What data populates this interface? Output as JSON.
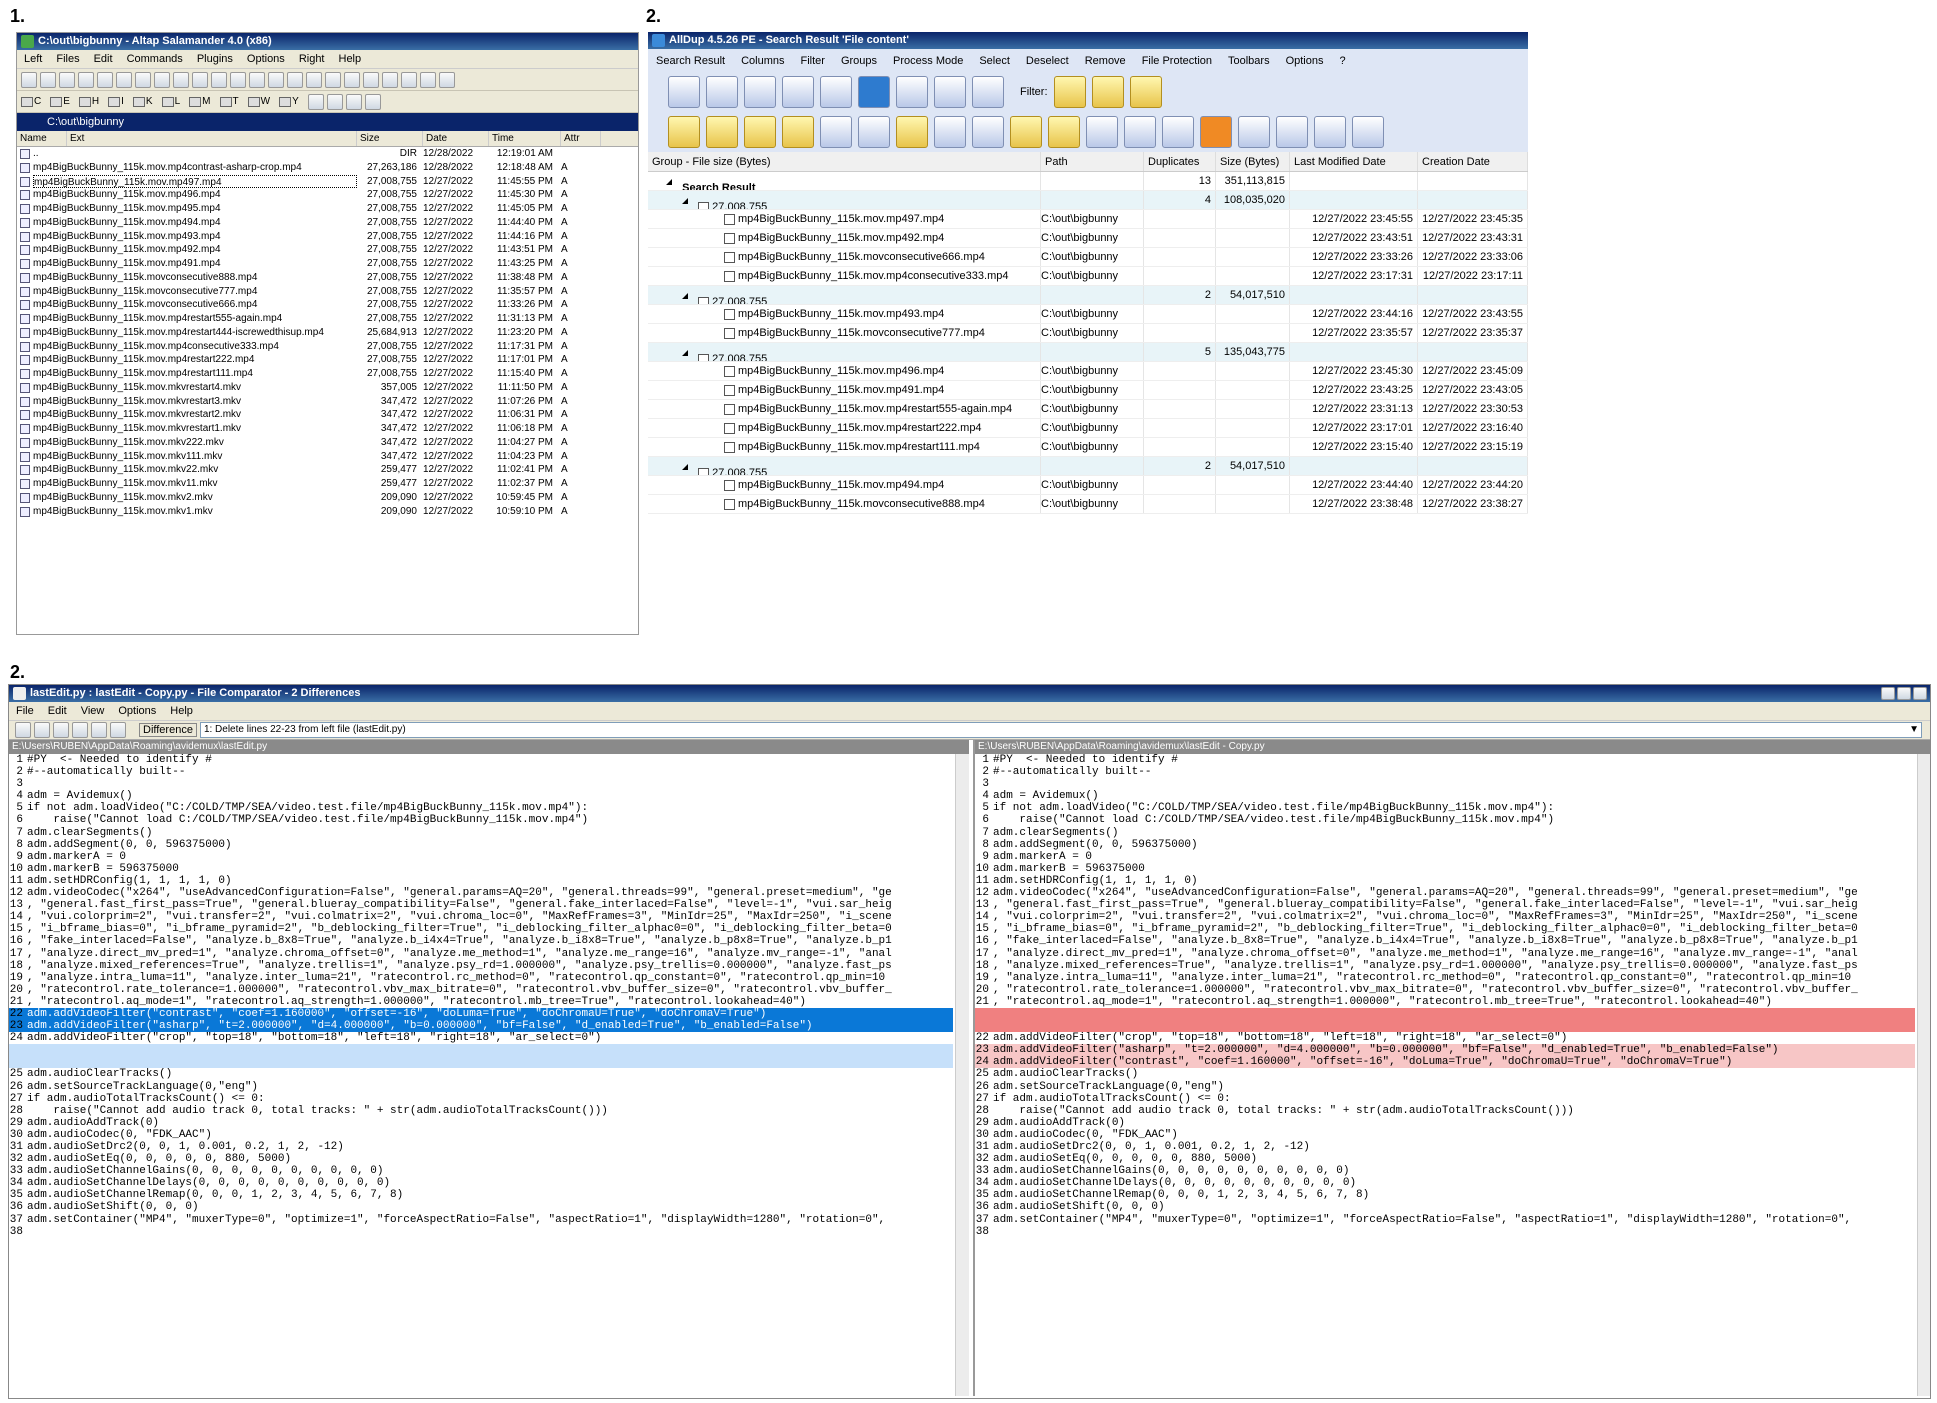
{
  "labels": {
    "one": "1.",
    "two_top": "2.",
    "two_bottom": "2."
  },
  "salamander": {
    "title": "C:\\out\\bigbunny - Altap Salamander 4.0 (x86)",
    "menu": [
      "Left",
      "Files",
      "Edit",
      "Commands",
      "Plugins",
      "Options",
      "Right",
      "Help"
    ],
    "drives": [
      "C",
      "E",
      "H",
      "I",
      "K",
      "L",
      "M",
      "T",
      "W",
      "Y"
    ],
    "path": "C:\\out\\bigbunny",
    "columns": [
      "Name",
      "Ext",
      "Size",
      "Date",
      "Time",
      "Attr"
    ],
    "files": [
      {
        "name": "..",
        "size": "DIR",
        "date": "12/28/2022",
        "time": "12:19:01 AM",
        "attr": ""
      },
      {
        "name": "mp4BigBuckBunny_115k.mov.mp4contrast-asharp-crop.mp4",
        "size": "27,263,186",
        "date": "12/28/2022",
        "time": "12:18:48 AM",
        "attr": "A"
      },
      {
        "name": "mp4BigBuckBunny_115k.mov.mp497.mp4",
        "size": "27,008,755",
        "date": "12/27/2022",
        "time": "11:45:55 PM",
        "attr": "A"
      },
      {
        "name": "mp4BigBuckBunny_115k.mov.mp496.mp4",
        "size": "27,008,755",
        "date": "12/27/2022",
        "time": "11:45:30 PM",
        "attr": "A"
      },
      {
        "name": "mp4BigBuckBunny_115k.mov.mp495.mp4",
        "size": "27,008,755",
        "date": "12/27/2022",
        "time": "11:45:05 PM",
        "attr": "A"
      },
      {
        "name": "mp4BigBuckBunny_115k.mov.mp494.mp4",
        "size": "27,008,755",
        "date": "12/27/2022",
        "time": "11:44:40 PM",
        "attr": "A"
      },
      {
        "name": "mp4BigBuckBunny_115k.mov.mp493.mp4",
        "size": "27,008,755",
        "date": "12/27/2022",
        "time": "11:44:16 PM",
        "attr": "A"
      },
      {
        "name": "mp4BigBuckBunny_115k.mov.mp492.mp4",
        "size": "27,008,755",
        "date": "12/27/2022",
        "time": "11:43:51 PM",
        "attr": "A"
      },
      {
        "name": "mp4BigBuckBunny_115k.mov.mp491.mp4",
        "size": "27,008,755",
        "date": "12/27/2022",
        "time": "11:43:25 PM",
        "attr": "A"
      },
      {
        "name": "mp4BigBuckBunny_115k.movconsecutive888.mp4",
        "size": "27,008,755",
        "date": "12/27/2022",
        "time": "11:38:48 PM",
        "attr": "A"
      },
      {
        "name": "mp4BigBuckBunny_115k.movconsecutive777.mp4",
        "size": "27,008,755",
        "date": "12/27/2022",
        "time": "11:35:57 PM",
        "attr": "A"
      },
      {
        "name": "mp4BigBuckBunny_115k.movconsecutive666.mp4",
        "size": "27,008,755",
        "date": "12/27/2022",
        "time": "11:33:26 PM",
        "attr": "A"
      },
      {
        "name": "mp4BigBuckBunny_115k.mov.mp4restart555-again.mp4",
        "size": "27,008,755",
        "date": "12/27/2022",
        "time": "11:31:13 PM",
        "attr": "A"
      },
      {
        "name": "mp4BigBuckBunny_115k.mov.mp4restart444-iscrewedthisup.mp4",
        "size": "25,684,913",
        "date": "12/27/2022",
        "time": "11:23:20 PM",
        "attr": "A"
      },
      {
        "name": "mp4BigBuckBunny_115k.mov.mp4consecutive333.mp4",
        "size": "27,008,755",
        "date": "12/27/2022",
        "time": "11:17:31 PM",
        "attr": "A"
      },
      {
        "name": "mp4BigBuckBunny_115k.mov.mp4restart222.mp4",
        "size": "27,008,755",
        "date": "12/27/2022",
        "time": "11:17:01 PM",
        "attr": "A"
      },
      {
        "name": "mp4BigBuckBunny_115k.mov.mp4restart111.mp4",
        "size": "27,008,755",
        "date": "12/27/2022",
        "time": "11:15:40 PM",
        "attr": "A"
      },
      {
        "name": "mp4BigBuckBunny_115k.mov.mkvrestart4.mkv",
        "size": "357,005",
        "date": "12/27/2022",
        "time": "11:11:50 PM",
        "attr": "A"
      },
      {
        "name": "mp4BigBuckBunny_115k.mov.mkvrestart3.mkv",
        "size": "347,472",
        "date": "12/27/2022",
        "time": "11:07:26 PM",
        "attr": "A"
      },
      {
        "name": "mp4BigBuckBunny_115k.mov.mkvrestart2.mkv",
        "size": "347,472",
        "date": "12/27/2022",
        "time": "11:06:31 PM",
        "attr": "A"
      },
      {
        "name": "mp4BigBuckBunny_115k.mov.mkvrestart1.mkv",
        "size": "347,472",
        "date": "12/27/2022",
        "time": "11:06:18 PM",
        "attr": "A"
      },
      {
        "name": "mp4BigBuckBunny_115k.mov.mkv222.mkv",
        "size": "347,472",
        "date": "12/27/2022",
        "time": "11:04:27 PM",
        "attr": "A"
      },
      {
        "name": "mp4BigBuckBunny_115k.mov.mkv111.mkv",
        "size": "347,472",
        "date": "12/27/2022",
        "time": "11:04:23 PM",
        "attr": "A"
      },
      {
        "name": "mp4BigBuckBunny_115k.mov.mkv22.mkv",
        "size": "259,477",
        "date": "12/27/2022",
        "time": "11:02:41 PM",
        "attr": "A"
      },
      {
        "name": "mp4BigBuckBunny_115k.mov.mkv11.mkv",
        "size": "259,477",
        "date": "12/27/2022",
        "time": "11:02:37 PM",
        "attr": "A"
      },
      {
        "name": "mp4BigBuckBunny_115k.mov.mkv2.mkv",
        "size": "209,090",
        "date": "12/27/2022",
        "time": "10:59:45 PM",
        "attr": "A"
      },
      {
        "name": "mp4BigBuckBunny_115k.mov.mkv1.mkv",
        "size": "209,090",
        "date": "12/27/2022",
        "time": "10:59:10 PM",
        "attr": "A"
      }
    ]
  },
  "alldup": {
    "title": "AllDup 4.5.26 PE - Search Result 'File content'",
    "menu": [
      "Search Result",
      "Columns",
      "Filter",
      "Groups",
      "Process Mode",
      "Select",
      "Deselect",
      "Remove",
      "File Protection",
      "Toolbars",
      "Options",
      "?"
    ],
    "filter_label": "Filter:",
    "columns": [
      "Group - File size (Bytes)",
      "Path",
      "Duplicates",
      "Size (Bytes)",
      "Last Modified Date",
      "Creation Date"
    ],
    "root": {
      "label": "Search Result",
      "dups": "13",
      "size": "351,113,815"
    },
    "groups": [
      {
        "label": "27,008,755",
        "dups": "4",
        "size": "108,035,020",
        "files": [
          {
            "name": "mp4BigBuckBunny_115k.mov.mp497.mp4",
            "path": "C:\\out\\bigbunny",
            "mod": "12/27/2022 23:45:55",
            "cre": "12/27/2022 23:45:35"
          },
          {
            "name": "mp4BigBuckBunny_115k.mov.mp492.mp4",
            "path": "C:\\out\\bigbunny",
            "mod": "12/27/2022 23:43:51",
            "cre": "12/27/2022 23:43:31"
          },
          {
            "name": "mp4BigBuckBunny_115k.movconsecutive666.mp4",
            "path": "C:\\out\\bigbunny",
            "mod": "12/27/2022 23:33:26",
            "cre": "12/27/2022 23:33:06"
          },
          {
            "name": "mp4BigBuckBunny_115k.mov.mp4consecutive333.mp4",
            "path": "C:\\out\\bigbunny",
            "mod": "12/27/2022 23:17:31",
            "cre": "12/27/2022 23:17:11"
          }
        ]
      },
      {
        "label": "27,008,755",
        "dups": "2",
        "size": "54,017,510",
        "files": [
          {
            "name": "mp4BigBuckBunny_115k.mov.mp493.mp4",
            "path": "C:\\out\\bigbunny",
            "mod": "12/27/2022 23:44:16",
            "cre": "12/27/2022 23:43:55"
          },
          {
            "name": "mp4BigBuckBunny_115k.movconsecutive777.mp4",
            "path": "C:\\out\\bigbunny",
            "mod": "12/27/2022 23:35:57",
            "cre": "12/27/2022 23:35:37"
          }
        ]
      },
      {
        "label": "27,008,755",
        "dups": "5",
        "size": "135,043,775",
        "files": [
          {
            "name": "mp4BigBuckBunny_115k.mov.mp496.mp4",
            "path": "C:\\out\\bigbunny",
            "mod": "12/27/2022 23:45:30",
            "cre": "12/27/2022 23:45:09"
          },
          {
            "name": "mp4BigBuckBunny_115k.mov.mp491.mp4",
            "path": "C:\\out\\bigbunny",
            "mod": "12/27/2022 23:43:25",
            "cre": "12/27/2022 23:43:05"
          },
          {
            "name": "mp4BigBuckBunny_115k.mov.mp4restart555-again.mp4",
            "path": "C:\\out\\bigbunny",
            "mod": "12/27/2022 23:31:13",
            "cre": "12/27/2022 23:30:53"
          },
          {
            "name": "mp4BigBuckBunny_115k.mov.mp4restart222.mp4",
            "path": "C:\\out\\bigbunny",
            "mod": "12/27/2022 23:17:01",
            "cre": "12/27/2022 23:16:40"
          },
          {
            "name": "mp4BigBuckBunny_115k.mov.mp4restart111.mp4",
            "path": "C:\\out\\bigbunny",
            "mod": "12/27/2022 23:15:40",
            "cre": "12/27/2022 23:15:19"
          }
        ]
      },
      {
        "label": "27,008,755",
        "dups": "2",
        "size": "54,017,510",
        "files": [
          {
            "name": "mp4BigBuckBunny_115k.mov.mp494.mp4",
            "path": "C:\\out\\bigbunny",
            "mod": "12/27/2022 23:44:40",
            "cre": "12/27/2022 23:44:20"
          },
          {
            "name": "mp4BigBuckBunny_115k.movconsecutive888.mp4",
            "path": "C:\\out\\bigbunny",
            "mod": "12/27/2022 23:38:48",
            "cre": "12/27/2022 23:38:27"
          }
        ]
      }
    ]
  },
  "comparator": {
    "title": "lastEdit.py : lastEdit - Copy.py - File Comparator - 2 Differences",
    "menu": [
      "File",
      "Edit",
      "View",
      "Options",
      "Help"
    ],
    "difference_label": "Difference",
    "difference_value": "1: Delete lines 22-23 from left file (lastEdit.py)",
    "left_path": "E:\\Users\\RUBEN\\AppData\\Roaming\\avidemux\\lastEdit.py",
    "right_path": "E:\\Users\\RUBEN\\AppData\\Roaming\\avidemux\\lastEdit - Copy.py",
    "left": [
      {
        "n": "1",
        "t": "#PY  <- Needed to identify #"
      },
      {
        "n": "2",
        "t": "#--automatically built--"
      },
      {
        "n": "3",
        "t": ""
      },
      {
        "n": "4",
        "t": "adm = Avidemux()"
      },
      {
        "n": "5",
        "t": "if not adm.loadVideo(\"C:/COLD/TMP/SEA/video.test.file/mp4BigBuckBunny_115k.mov.mp4\"):"
      },
      {
        "n": "6",
        "t": "    raise(\"Cannot load C:/COLD/TMP/SEA/video.test.file/mp4BigBuckBunny_115k.mov.mp4\")"
      },
      {
        "n": "7",
        "t": "adm.clearSegments()"
      },
      {
        "n": "8",
        "t": "adm.addSegment(0, 0, 596375000)"
      },
      {
        "n": "9",
        "t": "adm.markerA = 0"
      },
      {
        "n": "10",
        "t": "adm.markerB = 596375000"
      },
      {
        "n": "11",
        "t": "adm.setHDRConfig(1, 1, 1, 1, 0)"
      },
      {
        "n": "12",
        "t": "adm.videoCodec(\"x264\", \"useAdvancedConfiguration=False\", \"general.params=AQ=20\", \"general.threads=99\", \"general.preset=medium\", \"ge"
      },
      {
        "n": "13",
        "t": ", \"general.fast_first_pass=True\", \"general.blueray_compatibility=False\", \"general.fake_interlaced=False\", \"level=-1\", \"vui.sar_heig"
      },
      {
        "n": "14",
        "t": ", \"vui.colorprim=2\", \"vui.transfer=2\", \"vui.colmatrix=2\", \"vui.chroma_loc=0\", \"MaxRefFrames=3\", \"MinIdr=25\", \"MaxIdr=250\", \"i_scene"
      },
      {
        "n": "15",
        "t": ", \"i_bframe_bias=0\", \"i_bframe_pyramid=2\", \"b_deblocking_filter=True\", \"i_deblocking_filter_alphac0=0\", \"i_deblocking_filter_beta=0"
      },
      {
        "n": "16",
        "t": ", \"fake_interlaced=False\", \"analyze.b_8x8=True\", \"analyze.b_i4x4=True\", \"analyze.b_i8x8=True\", \"analyze.b_p8x8=True\", \"analyze.b_p1"
      },
      {
        "n": "17",
        "t": ", \"analyze.direct_mv_pred=1\", \"analyze.chroma_offset=0\", \"analyze.me_method=1\", \"analyze.me_range=16\", \"analyze.mv_range=-1\", \"anal"
      },
      {
        "n": "18",
        "t": ", \"analyze.mixed_references=True\", \"analyze.trellis=1\", \"analyze.psy_rd=1.000000\", \"analyze.psy_trellis=0.000000\", \"analyze.fast_ps"
      },
      {
        "n": "19",
        "t": ", \"analyze.intra_luma=11\", \"analyze.inter_luma=21\", \"ratecontrol.rc_method=0\", \"ratecontrol.qp_constant=0\", \"ratecontrol.qp_min=10"
      },
      {
        "n": "20",
        "t": ", \"ratecontrol.rate_tolerance=1.000000\", \"ratecontrol.vbv_max_bitrate=0\", \"ratecontrol.vbv_buffer_size=0\", \"ratecontrol.vbv_buffer_"
      },
      {
        "n": "21",
        "t": ", \"ratecontrol.aq_mode=1\", \"ratecontrol.aq_strength=1.000000\", \"ratecontrol.mb_tree=True\", \"ratecontrol.lookahead=40\")"
      },
      {
        "n": "22",
        "t": "adm.addVideoFilter(\"contrast\", \"coef=1.160000\", \"offset=-16\", \"doLuma=True\", \"doChromaU=True\", \"doChromaV=True\")",
        "c": "dl"
      },
      {
        "n": "23",
        "t": "adm.addVideoFilter(\"asharp\", \"t=2.000000\", \"d=4.000000\", \"b=0.000000\", \"bf=False\", \"d_enabled=True\", \"b_enabled=False\")",
        "c": "dl"
      },
      {
        "n": "24",
        "t": "adm.addVideoFilter(\"crop\", \"top=18\", \"bottom=18\", \"left=18\", \"right=18\", \"ar_select=0\")"
      },
      {
        "n": "",
        "t": "",
        "c": "dlp"
      },
      {
        "n": "",
        "t": "",
        "c": "dlp"
      },
      {
        "n": "25",
        "t": "adm.audioClearTracks()"
      },
      {
        "n": "26",
        "t": "adm.setSourceTrackLanguage(0,\"eng\")"
      },
      {
        "n": "27",
        "t": "if adm.audioTotalTracksCount() <= 0:"
      },
      {
        "n": "28",
        "t": "    raise(\"Cannot add audio track 0, total tracks: \" + str(adm.audioTotalTracksCount()))"
      },
      {
        "n": "29",
        "t": "adm.audioAddTrack(0)"
      },
      {
        "n": "30",
        "t": "adm.audioCodec(0, \"FDK_AAC\")"
      },
      {
        "n": "31",
        "t": "adm.audioSetDrc2(0, 0, 1, 0.001, 0.2, 1, 2, -12)"
      },
      {
        "n": "32",
        "t": "adm.audioSetEq(0, 0, 0, 0, 0, 880, 5000)"
      },
      {
        "n": "33",
        "t": "adm.audioSetChannelGains(0, 0, 0, 0, 0, 0, 0, 0, 0, 0)"
      },
      {
        "n": "34",
        "t": "adm.audioSetChannelDelays(0, 0, 0, 0, 0, 0, 0, 0, 0, 0)"
      },
      {
        "n": "35",
        "t": "adm.audioSetChannelRemap(0, 0, 0, 1, 2, 3, 4, 5, 6, 7, 8)"
      },
      {
        "n": "36",
        "t": "adm.audioSetShift(0, 0, 0)"
      },
      {
        "n": "37",
        "t": "adm.setContainer(\"MP4\", \"muxerType=0\", \"optimize=1\", \"forceAspectRatio=False\", \"aspectRatio=1\", \"displayWidth=1280\", \"rotation=0\","
      },
      {
        "n": "38",
        "t": ""
      }
    ],
    "right": [
      {
        "n": "1",
        "t": "#PY  <- Needed to identify #"
      },
      {
        "n": "2",
        "t": "#--automatically built--"
      },
      {
        "n": "3",
        "t": ""
      },
      {
        "n": "4",
        "t": "adm = Avidemux()"
      },
      {
        "n": "5",
        "t": "if not adm.loadVideo(\"C:/COLD/TMP/SEA/video.test.file/mp4BigBuckBunny_115k.mov.mp4\"):"
      },
      {
        "n": "6",
        "t": "    raise(\"Cannot load C:/COLD/TMP/SEA/video.test.file/mp4BigBuckBunny_115k.mov.mp4\")"
      },
      {
        "n": "7",
        "t": "adm.clearSegments()"
      },
      {
        "n": "8",
        "t": "adm.addSegment(0, 0, 596375000)"
      },
      {
        "n": "9",
        "t": "adm.markerA = 0"
      },
      {
        "n": "10",
        "t": "adm.markerB = 596375000"
      },
      {
        "n": "11",
        "t": "adm.setHDRConfig(1, 1, 1, 1, 0)"
      },
      {
        "n": "12",
        "t": "adm.videoCodec(\"x264\", \"useAdvancedConfiguration=False\", \"general.params=AQ=20\", \"general.threads=99\", \"general.preset=medium\", \"ge"
      },
      {
        "n": "13",
        "t": ", \"general.fast_first_pass=True\", \"general.blueray_compatibility=False\", \"general.fake_interlaced=False\", \"level=-1\", \"vui.sar_heig"
      },
      {
        "n": "14",
        "t": ", \"vui.colorprim=2\", \"vui.transfer=2\", \"vui.colmatrix=2\", \"vui.chroma_loc=0\", \"MaxRefFrames=3\", \"MinIdr=25\", \"MaxIdr=250\", \"i_scene"
      },
      {
        "n": "15",
        "t": ", \"i_bframe_bias=0\", \"i_bframe_pyramid=2\", \"b_deblocking_filter=True\", \"i_deblocking_filter_alphac0=0\", \"i_deblocking_filter_beta=0"
      },
      {
        "n": "16",
        "t": ", \"fake_interlaced=False\", \"analyze.b_8x8=True\", \"analyze.b_i4x4=True\", \"analyze.b_i8x8=True\", \"analyze.b_p8x8=True\", \"analyze.b_p1"
      },
      {
        "n": "17",
        "t": ", \"analyze.direct_mv_pred=1\", \"analyze.chroma_offset=0\", \"analyze.me_method=1\", \"analyze.me_range=16\", \"analyze.mv_range=-1\", \"anal"
      },
      {
        "n": "18",
        "t": ", \"analyze.mixed_references=True\", \"analyze.trellis=1\", \"analyze.psy_rd=1.000000\", \"analyze.psy_trellis=0.000000\", \"analyze.fast_ps"
      },
      {
        "n": "19",
        "t": ", \"analyze.intra_luma=11\", \"analyze.inter_luma=21\", \"ratecontrol.rc_method=0\", \"ratecontrol.qp_constant=0\", \"ratecontrol.qp_min=10"
      },
      {
        "n": "20",
        "t": ", \"ratecontrol.rate_tolerance=1.000000\", \"ratecontrol.vbv_max_bitrate=0\", \"ratecontrol.vbv_buffer_size=0\", \"ratecontrol.vbv_buffer_"
      },
      {
        "n": "21",
        "t": ", \"ratecontrol.aq_mode=1\", \"ratecontrol.aq_strength=1.000000\", \"ratecontrol.mb_tree=True\", \"ratecontrol.lookahead=40\")"
      },
      {
        "n": "",
        "t": "",
        "c": "dr"
      },
      {
        "n": "",
        "t": "",
        "c": "dr"
      },
      {
        "n": "22",
        "t": "adm.addVideoFilter(\"crop\", \"top=18\", \"bottom=18\", \"left=18\", \"right=18\", \"ar_select=0\")"
      },
      {
        "n": "23",
        "t": "adm.addVideoFilter(\"asharp\", \"t=2.000000\", \"d=4.000000\", \"b=0.000000\", \"bf=False\", \"d_enabled=True\", \"b_enabled=False\")",
        "c": "drl"
      },
      {
        "n": "24",
        "t": "adm.addVideoFilter(\"contrast\", \"coef=1.160000\", \"offset=-16\", \"doLuma=True\", \"doChromaU=True\", \"doChromaV=True\")",
        "c": "drl"
      },
      {
        "n": "25",
        "t": "adm.audioClearTracks()"
      },
      {
        "n": "26",
        "t": "adm.setSourceTrackLanguage(0,\"eng\")"
      },
      {
        "n": "27",
        "t": "if adm.audioTotalTracksCount() <= 0:"
      },
      {
        "n": "28",
        "t": "    raise(\"Cannot add audio track 0, total tracks: \" + str(adm.audioTotalTracksCount()))"
      },
      {
        "n": "29",
        "t": "adm.audioAddTrack(0)"
      },
      {
        "n": "30",
        "t": "adm.audioCodec(0, \"FDK_AAC\")"
      },
      {
        "n": "31",
        "t": "adm.audioSetDrc2(0, 0, 1, 0.001, 0.2, 1, 2, -12)"
      },
      {
        "n": "32",
        "t": "adm.audioSetEq(0, 0, 0, 0, 0, 880, 5000)"
      },
      {
        "n": "33",
        "t": "adm.audioSetChannelGains(0, 0, 0, 0, 0, 0, 0, 0, 0, 0)"
      },
      {
        "n": "34",
        "t": "adm.audioSetChannelDelays(0, 0, 0, 0, 0, 0, 0, 0, 0, 0)"
      },
      {
        "n": "35",
        "t": "adm.audioSetChannelRemap(0, 0, 0, 1, 2, 3, 4, 5, 6, 7, 8)"
      },
      {
        "n": "36",
        "t": "adm.audioSetShift(0, 0, 0)"
      },
      {
        "n": "37",
        "t": "adm.setContainer(\"MP4\", \"muxerType=0\", \"optimize=1\", \"forceAspectRatio=False\", \"aspectRatio=1\", \"displayWidth=1280\", \"rotation=0\","
      },
      {
        "n": "38",
        "t": ""
      }
    ]
  }
}
